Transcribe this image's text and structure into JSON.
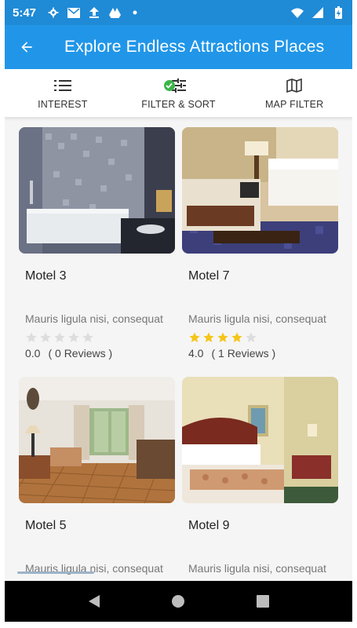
{
  "status_bar": {
    "time": "5:47",
    "icons_left": [
      "gear-icon",
      "gmail-icon",
      "upload-icon",
      "drive-icon",
      "dot-icon"
    ],
    "icons_right": [
      "wifi-icon",
      "signal-icon",
      "battery-icon"
    ]
  },
  "app_bar": {
    "title": "Explore Endless Attractions Places",
    "back_icon": "arrow-back-icon"
  },
  "tabs": [
    {
      "label": "INTEREST",
      "icon": "list-icon"
    },
    {
      "label": "FILTER & SORT",
      "icon": "sliders-icon"
    },
    {
      "label": "MAP FILTER",
      "icon": "map-icon"
    }
  ],
  "listings": [
    {
      "name": "Motel 3",
      "description": "Mauris ligula nisi, consequat",
      "rating": "0.0",
      "rating_value": 0,
      "reviews": "( 0 Reviews )",
      "image": "bathroom-photo"
    },
    {
      "name": "Motel 7",
      "description": "Mauris ligula nisi, consequat",
      "rating": "4.0",
      "rating_value": 4,
      "reviews": "( 1 Reviews )",
      "image": "hotel-room-photo"
    },
    {
      "name": "Motel 5",
      "description": "Mauris ligula nisi, consequat",
      "rating": "",
      "rating_value": null,
      "reviews": "",
      "image": "living-room-photo"
    },
    {
      "name": "Motel 9",
      "description": "Mauris ligula nisi, consequat",
      "rating": "",
      "rating_value": null,
      "reviews": "",
      "image": "bedroom-photo"
    }
  ],
  "colors": {
    "primary": "#2196e8",
    "primary_dark": "#1f8ad6",
    "star_filled": "#f5c518",
    "star_empty": "#dddddd",
    "check": "#3bb54a"
  },
  "nav_bar": {
    "buttons": [
      "back-triangle-icon",
      "home-circle-icon",
      "recents-square-icon"
    ]
  }
}
